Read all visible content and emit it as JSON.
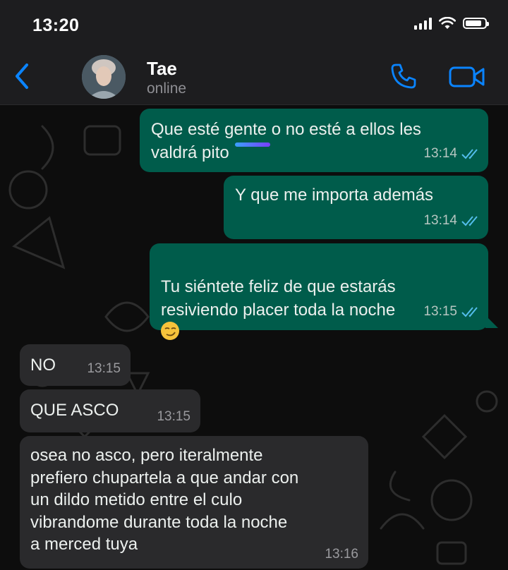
{
  "status_bar": {
    "time": "13:20",
    "icons": [
      "signal-icon",
      "wifi-icon",
      "battery-icon"
    ],
    "battery_level": 0.85
  },
  "header": {
    "back_icon": "chevron-left-icon",
    "contact_name": "Tae",
    "contact_status": "online",
    "call_icon": "phone-icon",
    "video_icon": "video-camera-icon"
  },
  "colors": {
    "accent": "#0a84ff",
    "outgoing_bubble": "#005c4b",
    "incoming_bubble": "#2a2a2c",
    "read_ticks": "#53bdeb"
  },
  "messages": [
    {
      "direction": "out",
      "text": "Que esté gente o no esté a ellos les\nvaldrá pito",
      "time": "13:14",
      "status": "read"
    },
    {
      "direction": "out",
      "text": "Y que me importa además",
      "time": "13:14",
      "status": "read"
    },
    {
      "direction": "out",
      "text": "Tu siéntete feliz de que estarás\nresiviendo placer toda la noche",
      "emoji": "smirking-face",
      "time": "13:15",
      "status": "read"
    },
    {
      "direction": "in",
      "text": "NO",
      "time": "13:15"
    },
    {
      "direction": "in",
      "text": "QUE ASCO",
      "time": "13:15"
    },
    {
      "direction": "in",
      "text": "osea no asco, pero iteralmente\nprefiero chupartela a que andar con\nun dildo metido entre el culo\nvibrandome durante toda la noche\na merced tuya",
      "time": "13:16"
    }
  ]
}
